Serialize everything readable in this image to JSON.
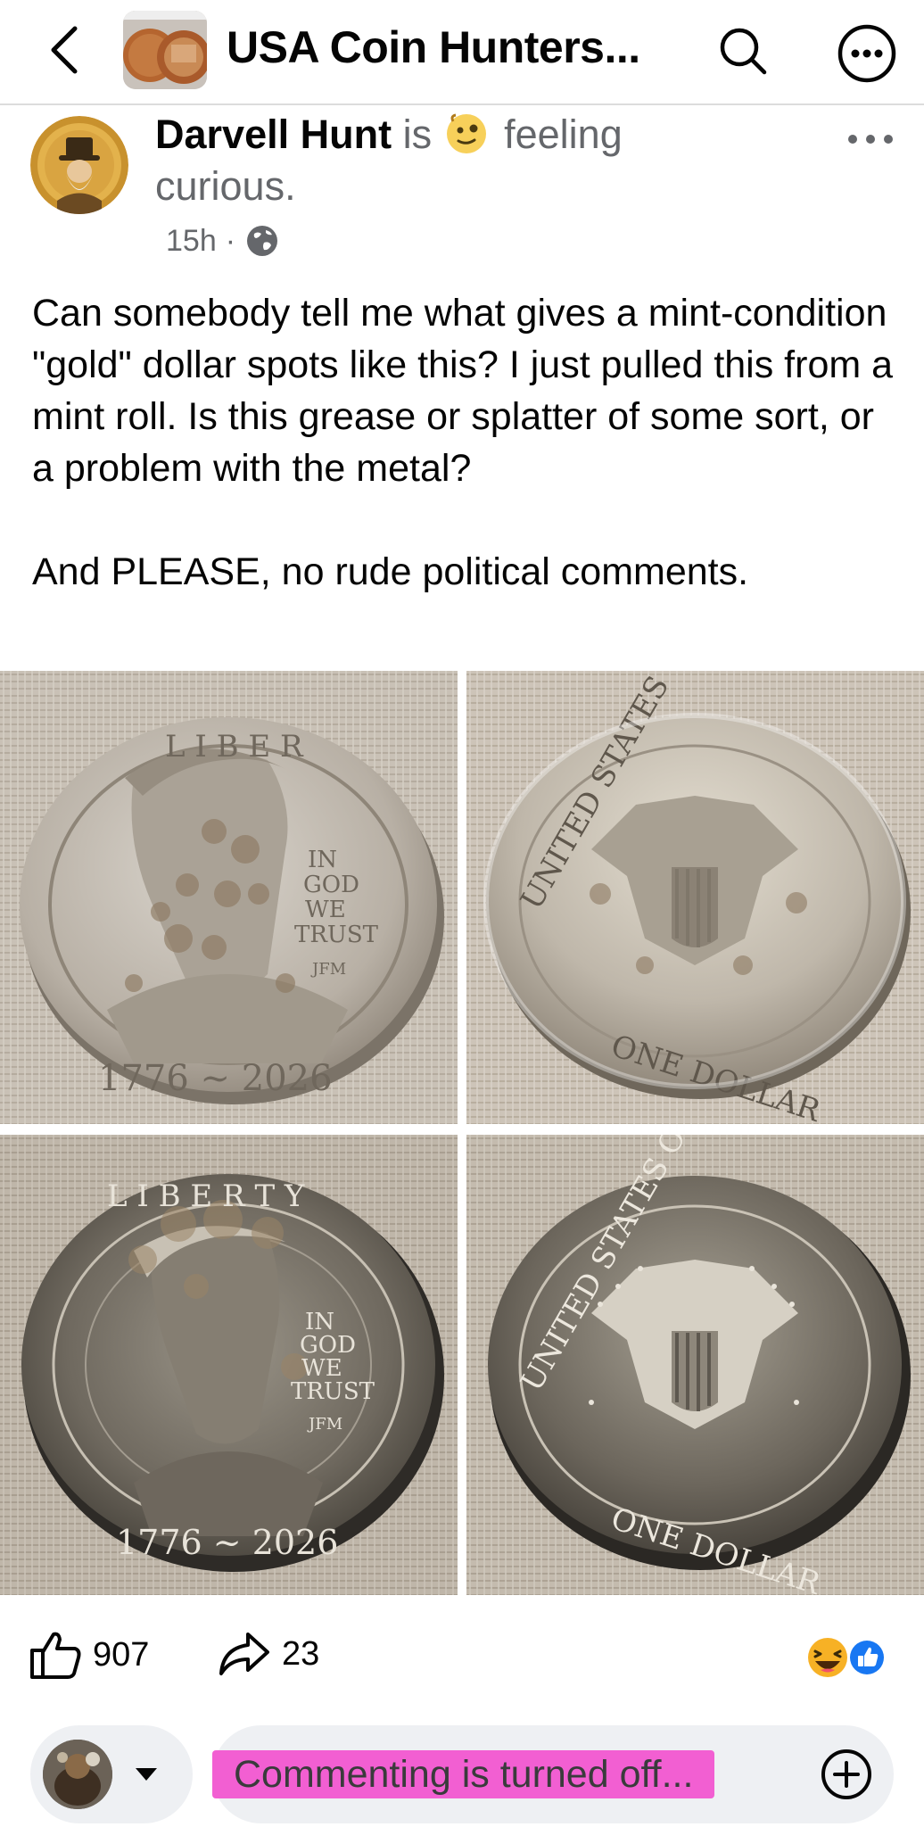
{
  "header": {
    "title": "USA Coin Hunters...",
    "icons": {
      "back": "chevron-left-icon",
      "search": "search-icon",
      "more": "more-options-icon"
    }
  },
  "post": {
    "author": "Darvell Hunt",
    "status_prefix": "is",
    "feeling_text": "feeling curious.",
    "time": "15h",
    "privacy_icon": "globe-icon",
    "paragraphs": [
      "Can somebody tell me what gives a mint-condition \"gold\" dollar spots like this? I just pulled this from a mint roll. Is this grease or splatter of some sort, or a problem with the metal?",
      "And PLEASE, no rude political comments."
    ],
    "photos": [
      {
        "alt": "coin-obverse-1"
      },
      {
        "alt": "coin-reverse-1"
      },
      {
        "alt": "coin-obverse-2"
      },
      {
        "alt": "coin-reverse-2"
      }
    ],
    "coin_inscriptions": {
      "obverse_top": "LIBERTY",
      "obverse_motto": "IN GOD WE TRUST",
      "obverse_dates": "1776 ~ 2026",
      "obverse_initials": "JFM",
      "reverse_top": "UNITED STATES OF AMERICA",
      "reverse_bottom": "ONE DOLLAR"
    }
  },
  "reactions": {
    "likes": "907",
    "shares": "23",
    "reaction_types": [
      "haha-icon",
      "like-icon"
    ]
  },
  "comment_bar": {
    "placeholder": "Commenting is turned off..."
  },
  "colors": {
    "text": "#050505",
    "secondary": "#65676b",
    "like_blue": "#1877f2",
    "haha_yellow": "#f7b125",
    "highlight_pink": "#f25fd2",
    "field_bg": "#eef0f3"
  }
}
